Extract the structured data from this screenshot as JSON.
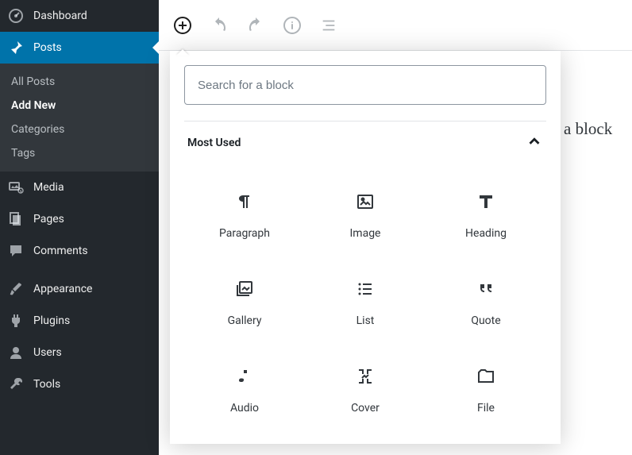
{
  "sidebar": {
    "items": [
      {
        "label": "Dashboard"
      },
      {
        "label": "Posts"
      },
      {
        "label": "Media"
      },
      {
        "label": "Pages"
      },
      {
        "label": "Comments"
      },
      {
        "label": "Appearance"
      },
      {
        "label": "Plugins"
      },
      {
        "label": "Users"
      },
      {
        "label": "Tools"
      }
    ],
    "posts_sub": [
      {
        "label": "All Posts"
      },
      {
        "label": "Add New"
      },
      {
        "label": "Categories"
      },
      {
        "label": "Tags"
      }
    ]
  },
  "inserter": {
    "search_placeholder": "Search for a block",
    "section_title": "Most Used",
    "blocks": [
      {
        "label": "Paragraph"
      },
      {
        "label": "Image"
      },
      {
        "label": "Heading"
      },
      {
        "label": "Gallery"
      },
      {
        "label": "List"
      },
      {
        "label": "Quote"
      },
      {
        "label": "Audio"
      },
      {
        "label": "Cover"
      },
      {
        "label": "File"
      }
    ]
  },
  "editor": {
    "background_text_fragment": "a block"
  }
}
